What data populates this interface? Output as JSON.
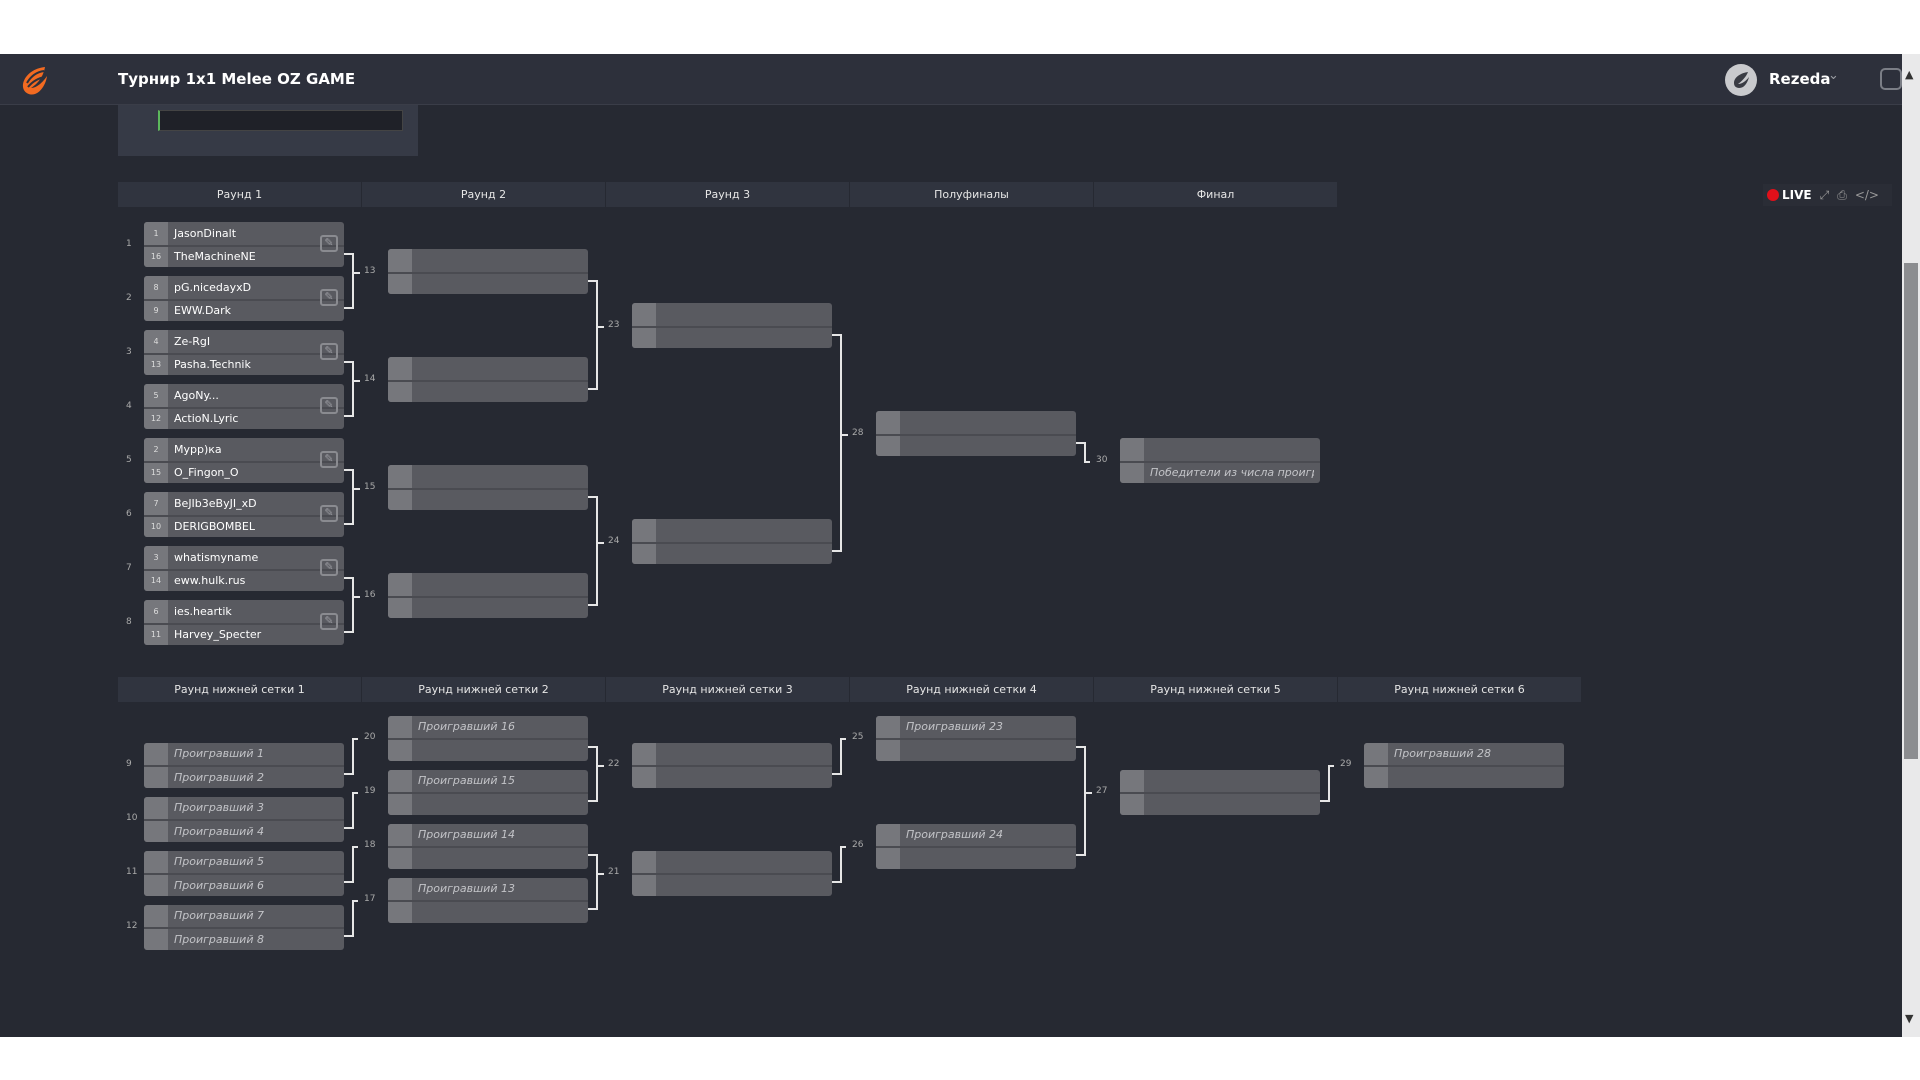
{
  "header": {
    "title": "Турнир 1x1 Melee OZ GAME",
    "user": "Rezeda",
    "logo": "flame-wing-logo",
    "avatar": "wing-avatar-icon"
  },
  "filter": {
    "value": ""
  },
  "toolbar": {
    "live": "LIVE",
    "live_color": "#e0101a",
    "icons": [
      "fullscreen-icon",
      "print-icon",
      "embed-code-icon"
    ]
  },
  "upper_rounds": [
    "Раунд 1",
    "Раунд 2",
    "Раунд 3",
    "Полуфиналы",
    "Финал"
  ],
  "lower_rounds": [
    "Раунд нижней сетки 1",
    "Раунд нижней сетки 2",
    "Раунд нижней сетки 3",
    "Раунд нижней сетки 4",
    "Раунд нижней сетки 5",
    "Раунд нижней сетки 6"
  ],
  "matches": [
    {
      "id": "1",
      "editable": true,
      "slots": [
        {
          "seed": "1",
          "name": "JasonDinalt"
        },
        {
          "seed": "16",
          "name": "TheMachineNE"
        }
      ]
    },
    {
      "id": "2",
      "editable": true,
      "slots": [
        {
          "seed": "8",
          "name": "pG.nicedayxD"
        },
        {
          "seed": "9",
          "name": "EWW.Dark"
        }
      ]
    },
    {
      "id": "3",
      "editable": true,
      "slots": [
        {
          "seed": "4",
          "name": "Ze-RgI"
        },
        {
          "seed": "13",
          "name": "Pasha.Technik"
        }
      ]
    },
    {
      "id": "4",
      "editable": true,
      "slots": [
        {
          "seed": "5",
          "name": "AgoNy..."
        },
        {
          "seed": "12",
          "name": "ActioN.Lyric"
        }
      ]
    },
    {
      "id": "5",
      "editable": true,
      "slots": [
        {
          "seed": "2",
          "name": "Мурр)ка"
        },
        {
          "seed": "15",
          "name": "O_Fingon_O"
        }
      ]
    },
    {
      "id": "6",
      "editable": true,
      "slots": [
        {
          "seed": "7",
          "name": "BeJIb3eByJI_xD"
        },
        {
          "seed": "10",
          "name": "DERIGBOMBEL"
        }
      ]
    },
    {
      "id": "7",
      "editable": true,
      "slots": [
        {
          "seed": "3",
          "name": "whatismyname"
        },
        {
          "seed": "14",
          "name": "eww.hulk.rus"
        }
      ]
    },
    {
      "id": "8",
      "editable": true,
      "slots": [
        {
          "seed": "6",
          "name": "ies.heartik"
        },
        {
          "seed": "11",
          "name": "Harvey_Specter"
        }
      ]
    },
    {
      "id": "13",
      "slots": [
        {
          "name": ""
        },
        {
          "name": ""
        }
      ]
    },
    {
      "id": "14",
      "slots": [
        {
          "name": ""
        },
        {
          "name": ""
        }
      ]
    },
    {
      "id": "15",
      "slots": [
        {
          "name": ""
        },
        {
          "name": ""
        }
      ]
    },
    {
      "id": "16",
      "slots": [
        {
          "name": ""
        },
        {
          "name": ""
        }
      ]
    },
    {
      "id": "23",
      "slots": [
        {
          "name": ""
        },
        {
          "name": ""
        }
      ]
    },
    {
      "id": "24",
      "slots": [
        {
          "name": ""
        },
        {
          "name": ""
        }
      ]
    },
    {
      "id": "28",
      "slots": [
        {
          "name": ""
        },
        {
          "name": ""
        }
      ]
    },
    {
      "id": "30",
      "slots": [
        {
          "name": ""
        },
        {
          "name": "Победители из числа проигр",
          "italic": true
        }
      ]
    },
    {
      "id": "9",
      "slots": [
        {
          "name": "Проигравший 1",
          "italic": true
        },
        {
          "name": "Проигравший 2",
          "italic": true
        }
      ]
    },
    {
      "id": "10",
      "slots": [
        {
          "name": "Проигравший 3",
          "italic": true
        },
        {
          "name": "Проигравший 4",
          "italic": true
        }
      ]
    },
    {
      "id": "11",
      "slots": [
        {
          "name": "Проигравший 5",
          "italic": true
        },
        {
          "name": "Проигравший 6",
          "italic": true
        }
      ]
    },
    {
      "id": "12",
      "slots": [
        {
          "name": "Проигравший 7",
          "italic": true
        },
        {
          "name": "Проигравший 8",
          "italic": true
        }
      ]
    },
    {
      "id": "20",
      "slots": [
        {
          "name": "Проигравший 16",
          "italic": true
        },
        {
          "name": ""
        }
      ]
    },
    {
      "id": "19",
      "slots": [
        {
          "name": "Проигравший 15",
          "italic": true
        },
        {
          "name": ""
        }
      ]
    },
    {
      "id": "18",
      "slots": [
        {
          "name": "Проигравший 14",
          "italic": true
        },
        {
          "name": ""
        }
      ]
    },
    {
      "id": "17",
      "slots": [
        {
          "name": "Проигравший 13",
          "italic": true
        },
        {
          "name": ""
        }
      ]
    },
    {
      "id": "22",
      "slots": [
        {
          "name": ""
        },
        {
          "name": ""
        }
      ]
    },
    {
      "id": "21",
      "slots": [
        {
          "name": ""
        },
        {
          "name": ""
        }
      ]
    },
    {
      "id": "25",
      "slots": [
        {
          "name": "Проигравший 23",
          "italic": true
        },
        {
          "name": ""
        }
      ]
    },
    {
      "id": "26",
      "slots": [
        {
          "name": "Проигравший 24",
          "italic": true
        },
        {
          "name": ""
        }
      ]
    },
    {
      "id": "27",
      "slots": [
        {
          "name": ""
        },
        {
          "name": ""
        }
      ]
    },
    {
      "id": "29",
      "slots": [
        {
          "name": "Проигравший 28",
          "italic": true
        },
        {
          "name": ""
        }
      ]
    }
  ]
}
